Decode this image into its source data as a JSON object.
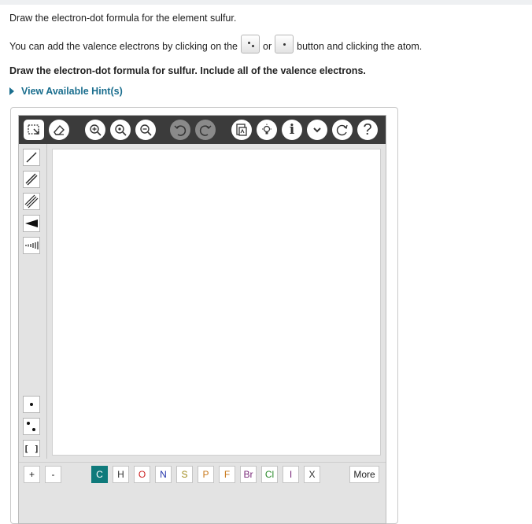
{
  "intro": "Draw the electron-dot formula for the element sulfur.",
  "instruction": {
    "part1": "You can add the valence electrons by clicking on the",
    "part2": "or",
    "part3": "button and clicking the atom."
  },
  "bold_instruction": "Draw the electron-dot formula for sulfur. Include all of the valence electrons.",
  "hints_link": "View Available Hint(s)",
  "toolbar": {
    "buttons": [
      "select-icon",
      "eraser-icon",
      "zoom-in-icon",
      "zoom-fit-icon",
      "zoom-out-icon",
      "undo-icon",
      "redo-icon",
      "template-icon",
      "lightbulb-icon",
      "info-icon",
      "chevron-down-icon",
      "refresh-icon",
      "help-icon"
    ],
    "help_label": "?",
    "info_label": "i"
  },
  "sidebar": {
    "bond_tools": [
      "single-bond",
      "double-bond",
      "triple-bond",
      "wedge-bond",
      "hash-bond"
    ],
    "electron_tools": [
      "single-electron",
      "electron-pair",
      "brackets"
    ],
    "brackets_label": "[ ]"
  },
  "element_bar": {
    "charges": [
      "+",
      "-"
    ],
    "elements": [
      {
        "symbol": "C",
        "color": "#ffffff",
        "active": true
      },
      {
        "symbol": "H",
        "color": "#333333"
      },
      {
        "symbol": "O",
        "color": "#cc2222"
      },
      {
        "symbol": "N",
        "color": "#2233aa"
      },
      {
        "symbol": "S",
        "color": "#a08a1a"
      },
      {
        "symbol": "P",
        "color": "#c9781a"
      },
      {
        "symbol": "F",
        "color": "#c9781a"
      },
      {
        "symbol": "Br",
        "color": "#7a2a7a"
      },
      {
        "symbol": "Cl",
        "color": "#2a8a2a"
      },
      {
        "symbol": "I",
        "color": "#7a2a7a"
      },
      {
        "symbol": "X",
        "color": "#333333"
      }
    ],
    "more_label": "More"
  }
}
